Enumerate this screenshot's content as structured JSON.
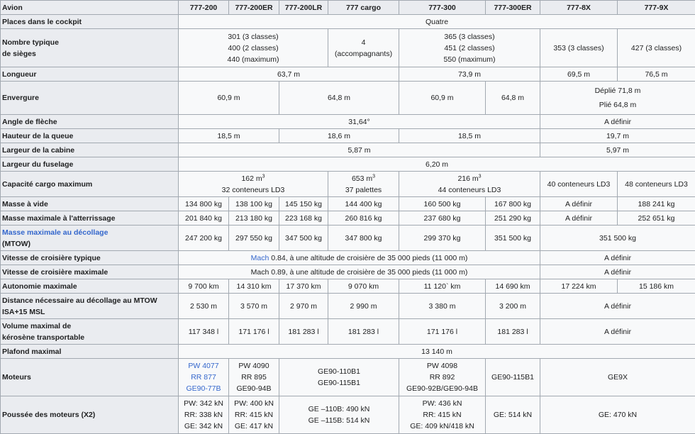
{
  "header": {
    "label": "Avion",
    "models": [
      "777-200",
      "777-200ER",
      "777-200LR",
      "777 cargo",
      "777-300",
      "777-300ER",
      "777-8X",
      "777-9X"
    ]
  },
  "rows": {
    "cockpit": {
      "label": "Places dans le cockpit",
      "v1": "Quatre"
    },
    "seats": {
      "label1": "Nombre typique",
      "label2": "de sièges",
      "g1": [
        "301 (3 classes)",
        "400 (2 classes)",
        "440 (maximum)"
      ],
      "cargo": [
        "4",
        "(accompagnants)"
      ],
      "g2": [
        "365 (3 classes)",
        "451 (2 classes)",
        "550 (maximum)"
      ],
      "x8": "353 (3 classes)",
      "x9": "427 (3 classes)"
    },
    "length": {
      "label": "Longueur",
      "a": "63,7 m",
      "b": "73,9 m",
      "c": "69,5 m",
      "d": "76,5 m"
    },
    "span": {
      "label": "Envergure",
      "a": "60,9 m",
      "b": "64,8 m",
      "c": "60,9 m",
      "d": "64,8 m",
      "e1": "Déplié 71,8 m",
      "e2": "Plié 64,8 m"
    },
    "sweep": {
      "label": "Angle de flèche",
      "a": "31,64°",
      "b": "A définir"
    },
    "tail": {
      "label": "Hauteur de la queue",
      "a": "18,5 m",
      "b": "18,6 m",
      "c": "18,5 m",
      "d": "19,7 m"
    },
    "cabin": {
      "label": "Largeur de la cabine",
      "a": "5,87 m",
      "b": "5,97 m"
    },
    "fuselage": {
      "label": "Largeur du fuselage",
      "a": "6,20 m"
    },
    "cargo": {
      "label": "Capacité cargo maximum",
      "a1": "162 m",
      "a2": "32 conteneurs LD3",
      "b1": "653 m",
      "b2": "37 palettes",
      "c1": "216 m",
      "c2": "44 conteneurs LD3",
      "sup": "3",
      "d": "40 conteneurs LD3",
      "e": "48 conteneurs LD3"
    },
    "empty": {
      "label": "Masse à vide",
      "v": [
        "134 800 kg",
        "138 100 kg",
        "145 150 kg",
        "144 400 kg",
        "160 500 kg",
        "167 800 kg",
        "A définir",
        "188 241 kg"
      ]
    },
    "landing": {
      "label": "Masse maximale à l'atterrissage",
      "v": [
        "201 840 kg",
        "213 180 kg",
        "223 168 kg",
        "260 816 kg",
        "237 680 kg",
        "251 290 kg",
        "A définir",
        "252 651 kg"
      ]
    },
    "mtow": {
      "label1": "Masse maximale au décollage",
      "label2": "(MTOW)",
      "v": [
        "247 200 kg",
        "297 550 kg",
        "347 500 kg",
        "347 800 kg",
        "299 370 kg",
        "351 500 kg"
      ],
      "x": "351 500 kg"
    },
    "cruise": {
      "label": "Vitesse de croisière typique",
      "mach": "Mach",
      "a": " 0.84, à une altitude de croisière de 35 000 pieds (11 000 m)",
      "b": "A définir"
    },
    "cruisemax": {
      "label": "Vitesse de croisière maximale",
      "a": "Mach 0.89, à une altitude de croisière de 35 000 pieds (11 000 m)",
      "b": "A définir"
    },
    "range": {
      "label": "Autonomie maximale",
      "v": [
        "9 700 km",
        "14 310 km",
        "17 370 km",
        "9 070 km",
        "11 120` km",
        "14 690 km",
        "17 224 km",
        "15 186 km"
      ]
    },
    "takeoff": {
      "label1": "Distance nécessaire au décollage au MTOW",
      "label2": "ISA+15 MSL",
      "v": [
        "2 530 m",
        "3 570 m",
        "2 970 m",
        "2 990 m",
        "3 380 m",
        "3 200 m"
      ],
      "x": "A définir"
    },
    "fuel": {
      "label1": "Volume maximal de",
      "label2": "kérosène transportable",
      "v": [
        "117 348 l",
        "171 176 l",
        "181 283 l",
        "181 283 l",
        "171 176 l",
        "181 283 l"
      ],
      "x": "A définir"
    },
    "ceiling": {
      "label": "Plafond maximal",
      "a": "13 140 m"
    },
    "engines": {
      "label": "Moteurs",
      "a": [
        "PW 4077",
        "RR 877",
        "GE90-77B"
      ],
      "b": [
        "PW 4090",
        "RR 895",
        "GE90-94B"
      ],
      "c": [
        "GE90-110B1",
        "GE90-115B1"
      ],
      "d": [
        "PW 4098",
        "RR 892",
        "GE90-92B/GE90-94B"
      ],
      "e": "GE90-115B1",
      "f": "GE9X"
    },
    "thrust": {
      "label": "Poussée des moteurs (X2)",
      "a": [
        "PW: 342 kN",
        "RR: 338 kN",
        "GE: 342 kN"
      ],
      "b": [
        "PW: 400 kN",
        "RR: 415 kN",
        "GE: 417 kN"
      ],
      "c": [
        "GE –110B: 490 kN",
        "GE –115B: 514 kN"
      ],
      "d": [
        "PW: 436 kN",
        "RR: 415 kN",
        "GE: 409 kN/418 kN"
      ],
      "e": "GE: 514 kN",
      "f": "GE: 470 kN"
    }
  },
  "colors": {
    "header_bg": "#eaecf0",
    "cell_bg": "#f8f9fa",
    "border": "#a2a9b1",
    "link": "#3366cc",
    "text": "#202122"
  }
}
